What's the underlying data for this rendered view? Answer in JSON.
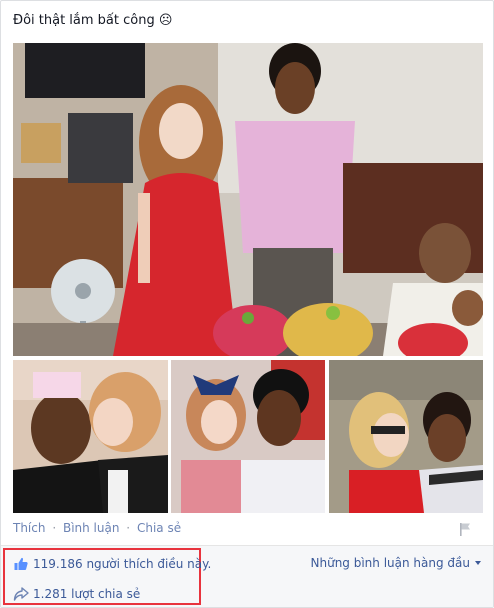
{
  "post": {
    "text": "Đôi thật lắm bất công ☹"
  },
  "actions": {
    "like": "Thích",
    "comment": "Bình luận",
    "share": "Chia sẻ",
    "separator": "·"
  },
  "ufi": {
    "likes_text": "119.186 người thích điều này.",
    "shares_text": "1.281 lượt chia sẻ",
    "sort_label": "Những bình luận hàng đầu"
  },
  "icons": {
    "like": "thumbs-up-icon",
    "share": "share-arrow-icon",
    "flag": "flag-icon",
    "sort": "chevron-down-icon"
  },
  "colors": {
    "link": "#6d84b4",
    "ufi_link": "#3b5998",
    "highlight": "#e8333d",
    "ufi_bg": "#f6f7f9"
  }
}
